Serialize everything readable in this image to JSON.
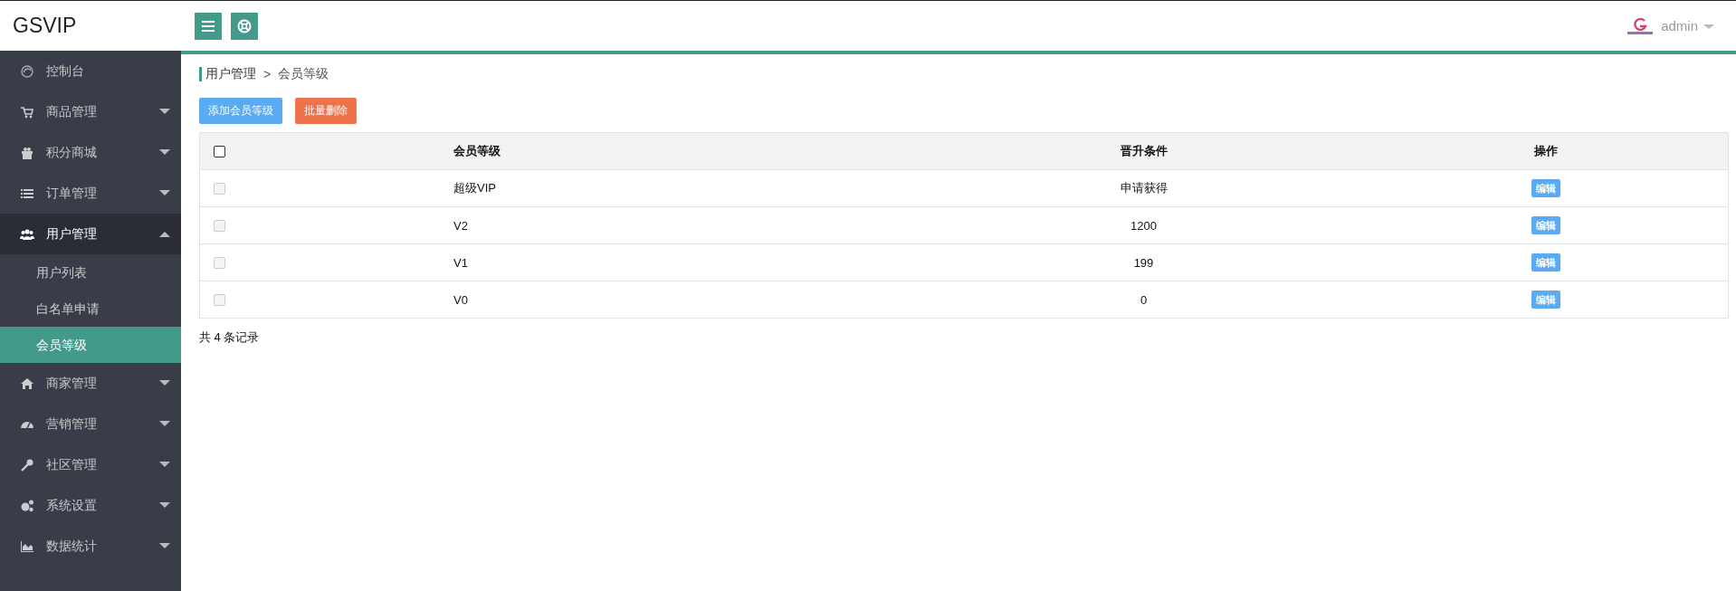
{
  "header": {
    "brand": "GSVIP",
    "user": "admin"
  },
  "sidebar": {
    "items": [
      {
        "label": "控制台",
        "kind": "link"
      },
      {
        "label": "商品管理",
        "kind": "group",
        "expanded": false
      },
      {
        "label": "积分商城",
        "kind": "group",
        "expanded": false
      },
      {
        "label": "订单管理",
        "kind": "group",
        "expanded": false
      },
      {
        "label": "用户管理",
        "kind": "group",
        "expanded": true,
        "children": [
          {
            "label": "用户列表",
            "selected": false
          },
          {
            "label": "白名单申请",
            "selected": false
          },
          {
            "label": "会员等级",
            "selected": true
          }
        ]
      },
      {
        "label": "商家管理",
        "kind": "group",
        "expanded": false
      },
      {
        "label": "营销管理",
        "kind": "group",
        "expanded": false
      },
      {
        "label": "社区管理",
        "kind": "group",
        "expanded": false
      },
      {
        "label": "系统设置",
        "kind": "group",
        "expanded": false
      },
      {
        "label": "数据统计",
        "kind": "group",
        "expanded": false
      }
    ]
  },
  "breadcrumb": [
    "用户管理",
    "会员等级"
  ],
  "breadcrumb_separator": ">",
  "actions": {
    "add": "添加会员等级",
    "delete": "批量删除"
  },
  "table": {
    "header_checkbox": {
      "checked": false
    },
    "columns": [
      "会员等级",
      "晋升条件",
      "操作"
    ],
    "rows": [
      {
        "checked": false,
        "disabled": true,
        "level": "超级VIP",
        "condition": "申请获得",
        "action": "编辑"
      },
      {
        "checked": false,
        "disabled": true,
        "level": "V2",
        "condition": "1200",
        "action": "编辑"
      },
      {
        "checked": false,
        "disabled": true,
        "level": "V1",
        "condition": "199",
        "action": "编辑"
      },
      {
        "checked": false,
        "disabled": true,
        "level": "V0",
        "condition": "0",
        "action": "编辑"
      }
    ]
  },
  "footer": "共 4 条记录"
}
